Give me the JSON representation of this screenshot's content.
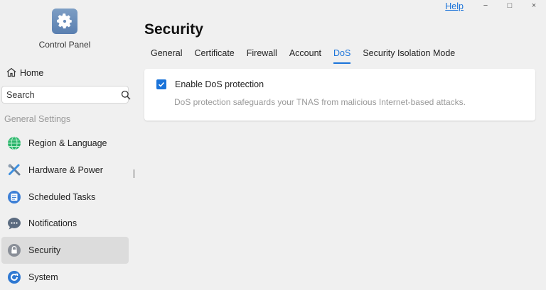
{
  "app": {
    "title": "Control Panel",
    "icon": "gear-icon",
    "accent_color": "#1a73d9"
  },
  "titlebar": {
    "help_label": "Help",
    "minimize_label": "−",
    "maximize_label": "□",
    "close_label": "×"
  },
  "sidebar": {
    "home_label": "Home",
    "search": {
      "placeholder": "Search",
      "value": ""
    },
    "section_label": "General Settings",
    "items": [
      {
        "label": "Region & Language",
        "icon": "globe-icon",
        "active": false
      },
      {
        "label": "Hardware & Power",
        "icon": "tools-icon",
        "active": false
      },
      {
        "label": "Scheduled Tasks",
        "icon": "tasks-icon",
        "active": false
      },
      {
        "label": "Notifications",
        "icon": "chat-bubble-icon",
        "active": false
      },
      {
        "label": "Security",
        "icon": "lock-icon",
        "active": true
      },
      {
        "label": "System",
        "icon": "system-icon",
        "active": false
      }
    ]
  },
  "main": {
    "page_title": "Security",
    "tabs": [
      {
        "label": "General",
        "active": false
      },
      {
        "label": "Certificate",
        "active": false
      },
      {
        "label": "Firewall",
        "active": false
      },
      {
        "label": "Account",
        "active": false
      },
      {
        "label": "DoS",
        "active": true
      },
      {
        "label": "Security Isolation Mode",
        "active": false
      }
    ],
    "dos": {
      "checkbox_label": "Enable DoS protection",
      "checked": true,
      "description": "DoS protection safeguards your TNAS from malicious Internet-based attacks."
    }
  }
}
